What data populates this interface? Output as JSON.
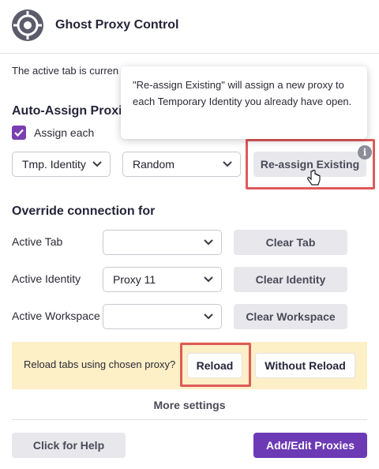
{
  "header": {
    "title": "Ghost Proxy Control",
    "logo_icon": "ghost-proxy-logo"
  },
  "active_tab_text": "The active tab is curren",
  "tooltip": {
    "text": "\"Re-assign Existing\" will assign a new proxy to each Temporary Identity you already have open."
  },
  "auto_assign": {
    "title": "Auto-Assign Proxie",
    "checkbox_label": "Assign each",
    "checked": true,
    "identity_select": "Tmp. Identity",
    "mode_select": "Random",
    "reassign_button": "Re-assign Existing",
    "info_icon": "i"
  },
  "override": {
    "title": "Override connection for",
    "rows": [
      {
        "label": "Active Tab",
        "select_value": "",
        "button": "Clear Tab"
      },
      {
        "label": "Active Identity",
        "select_value": "Proxy 11",
        "button": "Clear Identity"
      },
      {
        "label": "Active Workspace",
        "select_value": "",
        "button": "Clear Workspace"
      }
    ]
  },
  "reload": {
    "prompt": "Reload tabs using chosen proxy?",
    "reload_button": "Reload",
    "without_reload_button": "Without Reload"
  },
  "more_settings": "More settings",
  "footer": {
    "help_button": "Click for Help",
    "add_edit_button": "Add/Edit Proxies"
  },
  "colors": {
    "accent": "#6c3ab5",
    "highlight": "#de5a5a",
    "reload_bar": "#fdefc6"
  }
}
